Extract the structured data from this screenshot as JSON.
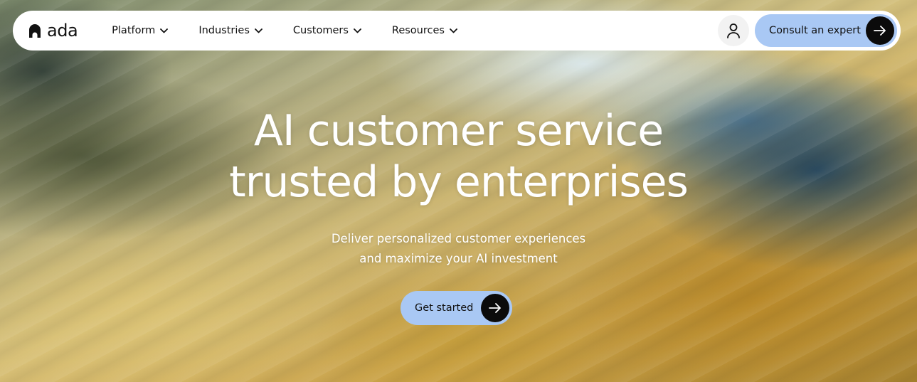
{
  "brand": {
    "name": "ada",
    "logo_icon": "ada-logo-arch-icon"
  },
  "nav": {
    "items": [
      {
        "label": "Platform",
        "icon": "chevron-down-icon"
      },
      {
        "label": "Industries",
        "icon": "chevron-down-icon"
      },
      {
        "label": "Customers",
        "icon": "chevron-down-icon"
      },
      {
        "label": "Resources",
        "icon": "chevron-down-icon"
      }
    ],
    "account_icon": "user-icon",
    "cta_label": "Consult an expert",
    "cta_icon": "arrow-right-icon"
  },
  "hero": {
    "headline_line1": "AI customer service",
    "headline_line2": "trusted by enterprises",
    "subhead_line1": "Deliver personalized customer experiences",
    "subhead_line2": "and maximize your AI investment",
    "cta_label": "Get started",
    "cta_icon": "arrow-right-icon"
  },
  "colors": {
    "button_bg": "#a9c8f4",
    "arrow_circle": "#0b0b0b",
    "nav_bg": "#ffffff",
    "headline_text": "#ffffff"
  }
}
